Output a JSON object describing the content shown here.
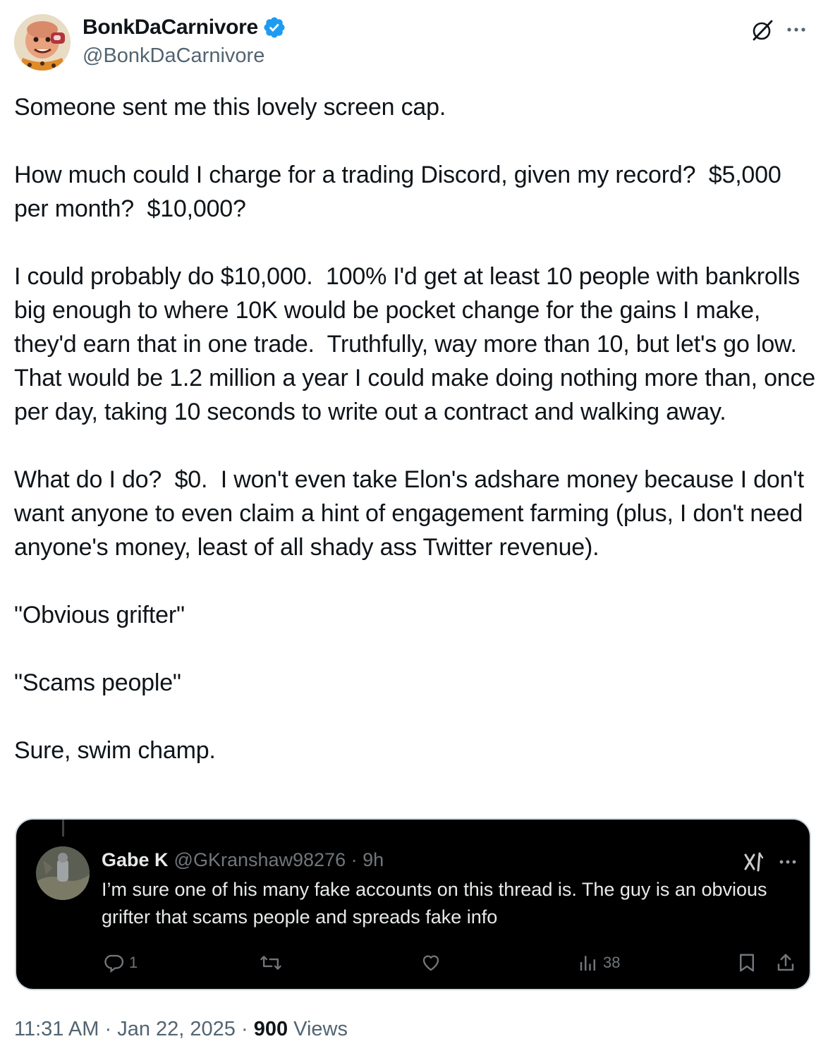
{
  "author": {
    "name": "BonkDaCarnivore",
    "handle": "@BonkDaCarnivore",
    "verified": true
  },
  "header_icons": [
    "grok-icon",
    "more-icon"
  ],
  "tweet": {
    "paragraphs": [
      "Someone sent me this lovely screen cap.",
      "How much could I charge for a trading Discord, given my record?  $5,000 per month?  $10,000?",
      "I could probably do $10,000.  100% I'd get at least 10 people with bankrolls big enough to where 10K would be pocket change for the gains I make, they'd earn that in one trade.  Truthfully, way more than 10, but let's go low.  That would be 1.2 million a year I could make doing nothing more than, once per day, taking 10 seconds to write out a contract and walking away.",
      "What do I do?  $0.  I won't even take Elon's adshare money because I don't want anyone to even claim a hint of engagement farming (plus, I don't need anyone's money, least of all shady ass Twitter revenue).",
      "\"Obvious grifter\"",
      "\"Scams people\"",
      "Sure, swim champ."
    ]
  },
  "embedded_screenshot": {
    "name": "Gabe K",
    "handle": "@GKranshaw98276",
    "separator": "·",
    "time": "9h",
    "text": "I’m sure one of his many fake accounts on this thread is.  The guy is an obvious grifter that scams people and spreads fake info",
    "replies": "1",
    "views": "38"
  },
  "footer": {
    "time": "11:31 AM",
    "separator": "·",
    "date": "Jan 22, 2025",
    "views_count": "900",
    "views_label": "Views"
  },
  "colors": {
    "text": "#0f1419",
    "secondary": "#536471",
    "verified": "#1d9bf0",
    "embed_bg": "#000000"
  }
}
